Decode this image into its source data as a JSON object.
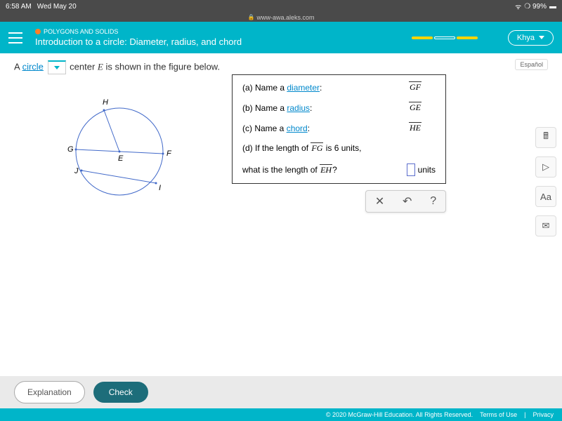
{
  "status": {
    "time": "6:58 AM",
    "date": "Wed May 20",
    "battery": "99%"
  },
  "url": "www-awa.aleks.com",
  "header": {
    "category": "POLYGONS AND SOLIDS",
    "title": "Introduction to a circle: Diameter, radius, and chord",
    "user": "Khya"
  },
  "espanol": "Español",
  "prompt": {
    "p1": "A ",
    "link1": "circle",
    "p2": "center ",
    "var1": "E",
    "p3": " is shown in the figure below."
  },
  "circle": {
    "labels": [
      "H",
      "G",
      "F",
      "E",
      "J",
      "I"
    ]
  },
  "questions": {
    "a": {
      "label": "(a) Name a ",
      "link": "diameter",
      "ans": "GF"
    },
    "b": {
      "label": "(b) Name a ",
      "link": "radius",
      "ans": "GE"
    },
    "c": {
      "label": "(c) Name a ",
      "link": "chord",
      "ans": "HE"
    },
    "d1": "(d) If the length of ",
    "d_seg": "FG",
    "d2": " is ",
    "d_val": "6",
    "d3": " units,",
    "e1": "what is the length of ",
    "e_seg": "EH",
    "e2": "?",
    "units": "units"
  },
  "toolbar": {
    "x": "✕",
    "undo": "↶",
    "help": "?"
  },
  "side": {
    "calc": "🖩",
    "play": "▷",
    "font": "Aa",
    "mail": "✉"
  },
  "buttons": {
    "explanation": "Explanation",
    "check": "Check"
  },
  "footer": {
    "copy": "© 2020 McGraw-Hill Education. All Rights Reserved.",
    "terms": "Terms of Use",
    "privacy": "Privacy"
  }
}
